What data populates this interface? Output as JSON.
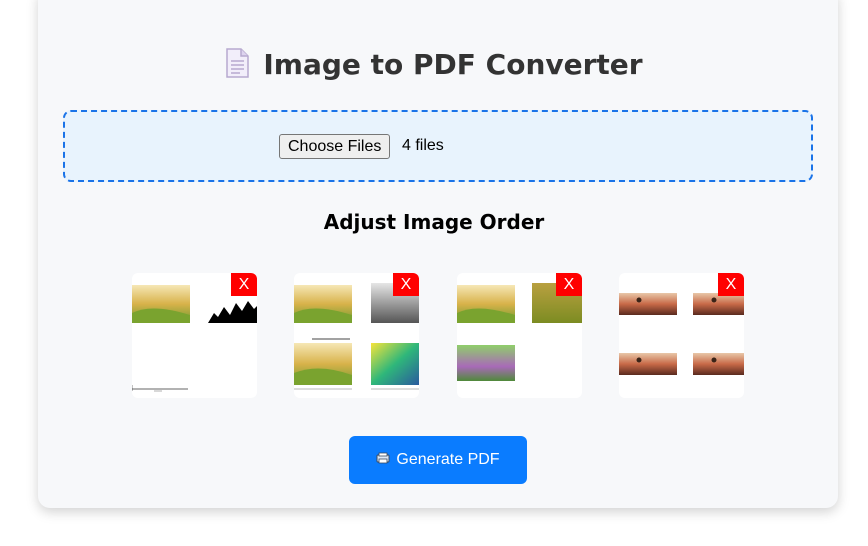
{
  "header": {
    "title": "Image to PDF Converter",
    "icon": "document-icon"
  },
  "upload": {
    "button_label": "Choose Files",
    "status": "4 files"
  },
  "order": {
    "heading": "Adjust Image Order",
    "remove_label": "X",
    "thumbnails": [
      {
        "name": "thumbnail-1",
        "description": "rice field, binary mask, plot"
      },
      {
        "name": "thumbnail-2",
        "description": "rice field, grayscale, colormap views"
      },
      {
        "name": "thumbnail-3",
        "description": "rice field variants, purple tint"
      },
      {
        "name": "thumbnail-4",
        "description": "four farmer images"
      }
    ]
  },
  "actions": {
    "generate_label": "Generate PDF",
    "generate_icon": "printer-icon"
  },
  "colors": {
    "accent": "#0a7cff",
    "dropzone_border": "#1a73e8",
    "remove": "#ff0000"
  }
}
